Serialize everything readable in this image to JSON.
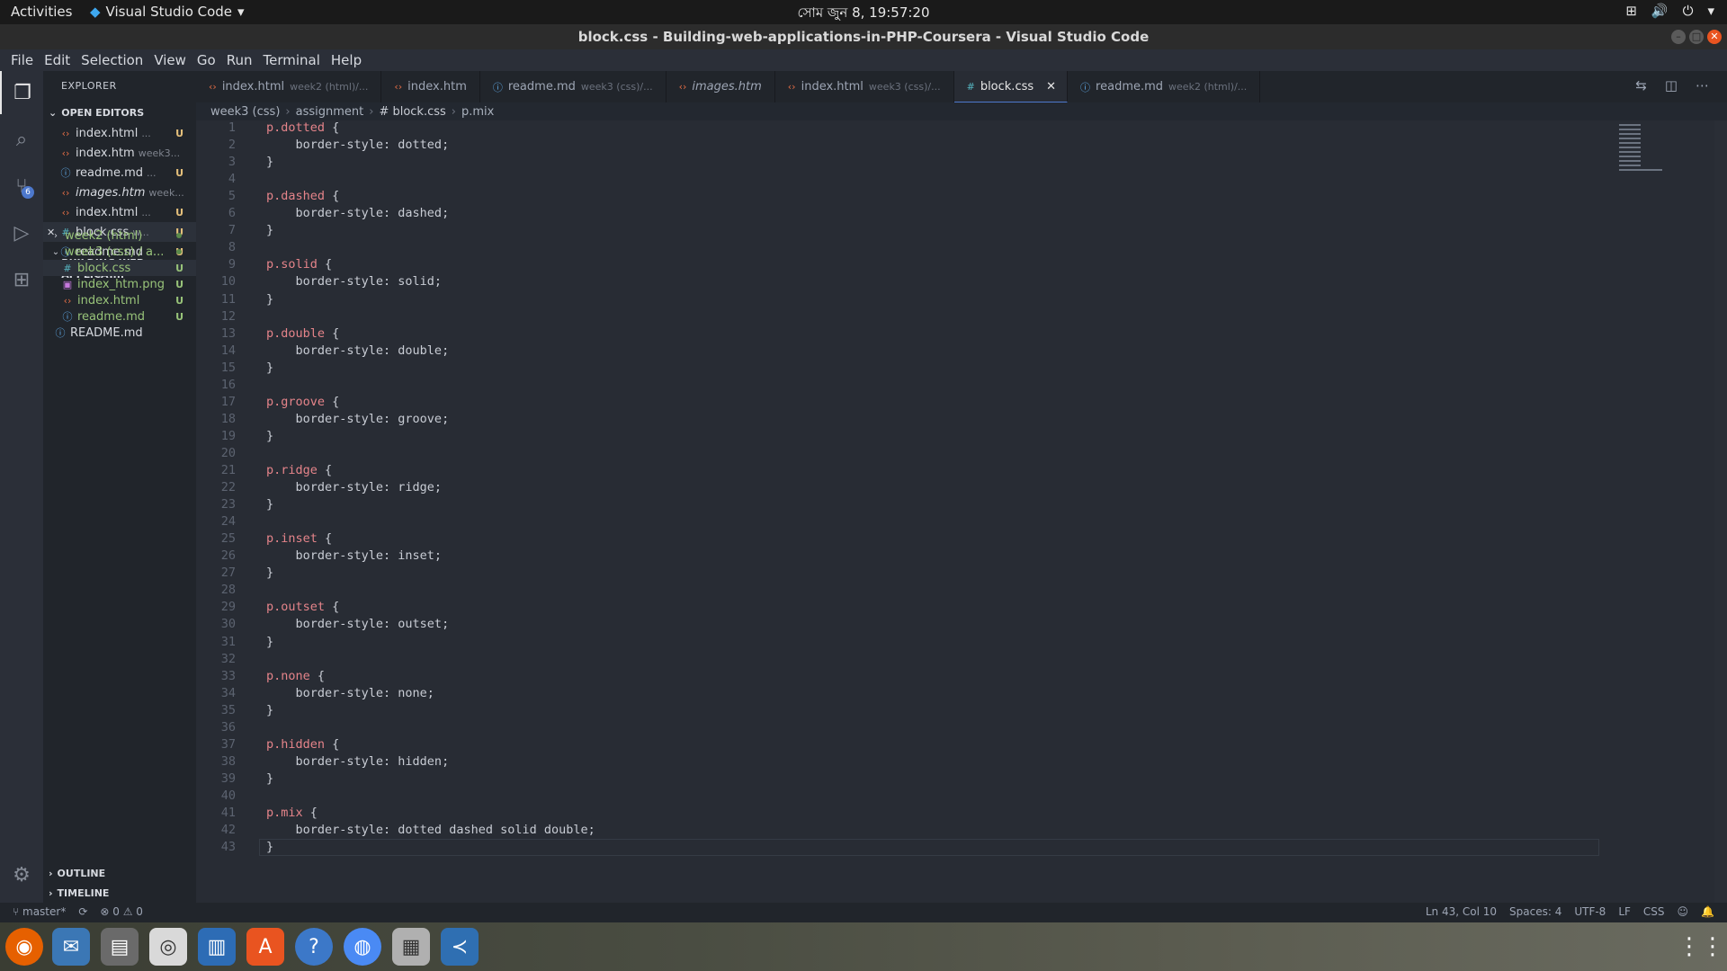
{
  "topbar": {
    "activities": "Activities",
    "app": "Visual Studio Code",
    "clock": "সোম জুন  8, 19:57:20"
  },
  "window": {
    "title": "block.css - Building-web-applications-in-PHP-Coursera - Visual Studio Code"
  },
  "menu": [
    "File",
    "Edit",
    "Selection",
    "View",
    "Go",
    "Run",
    "Terminal",
    "Help"
  ],
  "activity": {
    "badge": "6"
  },
  "explorer": {
    "title": "EXPLORER",
    "open_editors_label": "OPEN EDITORS",
    "open_editors": [
      {
        "name": "index.html",
        "desc": "...",
        "status": "U",
        "type": "html",
        "italic": false
      },
      {
        "name": "index.htm",
        "desc": "week3...",
        "status": "",
        "type": "html",
        "italic": false
      },
      {
        "name": "readme.md",
        "desc": "...",
        "status": "U",
        "type": "md",
        "italic": false
      },
      {
        "name": "images.htm",
        "desc": "week...",
        "status": "",
        "type": "html",
        "italic": true
      },
      {
        "name": "index.html",
        "desc": "...",
        "status": "U",
        "type": "html",
        "italic": false
      },
      {
        "name": "block.css",
        "desc": "w...",
        "status": "U",
        "type": "css",
        "italic": false
      },
      {
        "name": "readme.md",
        "desc": "...",
        "status": "U",
        "type": "md",
        "italic": false
      }
    ],
    "project_label": "BUILDING-WEB-APPLICAT...",
    "tree": [
      {
        "name": "week2 (html)",
        "kind": "folder-closed",
        "dot": true
      },
      {
        "name": "week3 (css) / a...",
        "kind": "folder-open",
        "dot": true
      },
      {
        "name": "block.css",
        "kind": "css",
        "status": "U"
      },
      {
        "name": "index_htm.png",
        "kind": "png",
        "status": "U"
      },
      {
        "name": "index.html",
        "kind": "html",
        "status": "U"
      },
      {
        "name": "readme.md",
        "kind": "md",
        "status": "U"
      },
      {
        "name": "README.md",
        "kind": "md-root",
        "status": ""
      }
    ],
    "outline_label": "OUTLINE",
    "timeline_label": "TIMELINE"
  },
  "tabs": [
    {
      "name": "index.html",
      "desc": "week2 (html)/...",
      "type": "html"
    },
    {
      "name": "index.htm",
      "desc": "",
      "type": "html"
    },
    {
      "name": "readme.md",
      "desc": "week3 (css)/...",
      "type": "md"
    },
    {
      "name": "images.htm",
      "desc": "",
      "type": "html",
      "italic": true
    },
    {
      "name": "index.html",
      "desc": "week3 (css)/...",
      "type": "html"
    },
    {
      "name": "block.css",
      "desc": "",
      "type": "css",
      "active": true
    },
    {
      "name": "readme.md",
      "desc": "week2 (html)/...",
      "type": "md"
    }
  ],
  "breadcrumb": [
    "week3 (css)",
    "assignment",
    "# block.css",
    "p.mix"
  ],
  "code": [
    "p.dotted {",
    "    border-style: dotted;",
    "}",
    "",
    "p.dashed {",
    "    border-style: dashed;",
    "}",
    "",
    "p.solid {",
    "    border-style: solid;",
    "}",
    "",
    "p.double {",
    "    border-style: double;",
    "}",
    "",
    "p.groove {",
    "    border-style: groove;",
    "}",
    "",
    "p.ridge {",
    "    border-style: ridge;",
    "}",
    "",
    "p.inset {",
    "    border-style: inset;",
    "}",
    "",
    "p.outset {",
    "    border-style: outset;",
    "}",
    "",
    "p.none {",
    "    border-style: none;",
    "}",
    "",
    "p.hidden {",
    "    border-style: hidden;",
    "}",
    "",
    "p.mix {",
    "    border-style: dotted dashed solid double;",
    "}"
  ],
  "status": {
    "branch": "master*",
    "problems": "⊗ 0 ⚠ 0",
    "position": "Ln 43, Col 10",
    "spaces": "Spaces: 4",
    "encoding": "UTF-8",
    "eol": "LF",
    "lang": "CSS"
  }
}
